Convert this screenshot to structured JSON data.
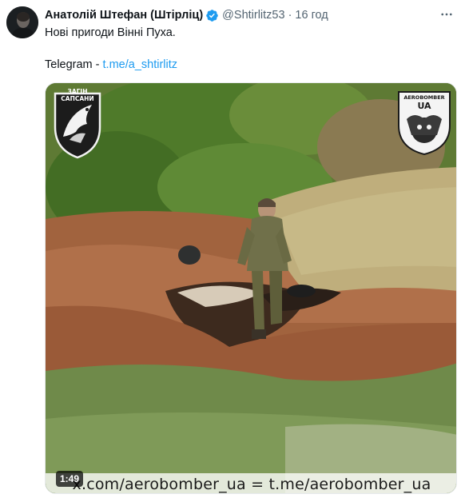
{
  "tweet": {
    "author_name": "Анатолій Штефан (Штірліц)",
    "handle": "@Shtirlitz53",
    "separator": "·",
    "time": "16 год",
    "text_line1": "Нові пригоди Вінні Пуха.",
    "telegram_label": "Telegram - ",
    "telegram_link": "t.me/a_shtirlitz"
  },
  "media": {
    "duration": "1:49",
    "watermark": "x.com/aerobomber_ua   =   t.me/aerobomber_ua",
    "badge_left_text": "ЗАГІН САПСАНИ",
    "badge_right_top": "AEROBOMBER",
    "badge_right_mid": "UA"
  },
  "icons": {
    "verified": "verified-badge-icon",
    "menu": "more-options-icon",
    "avatar": "profile-avatar"
  },
  "colors": {
    "link": "#1d9bf0",
    "verified": "#1d9bf0",
    "secondary_text": "#536471",
    "primary_text": "#0f1419"
  }
}
